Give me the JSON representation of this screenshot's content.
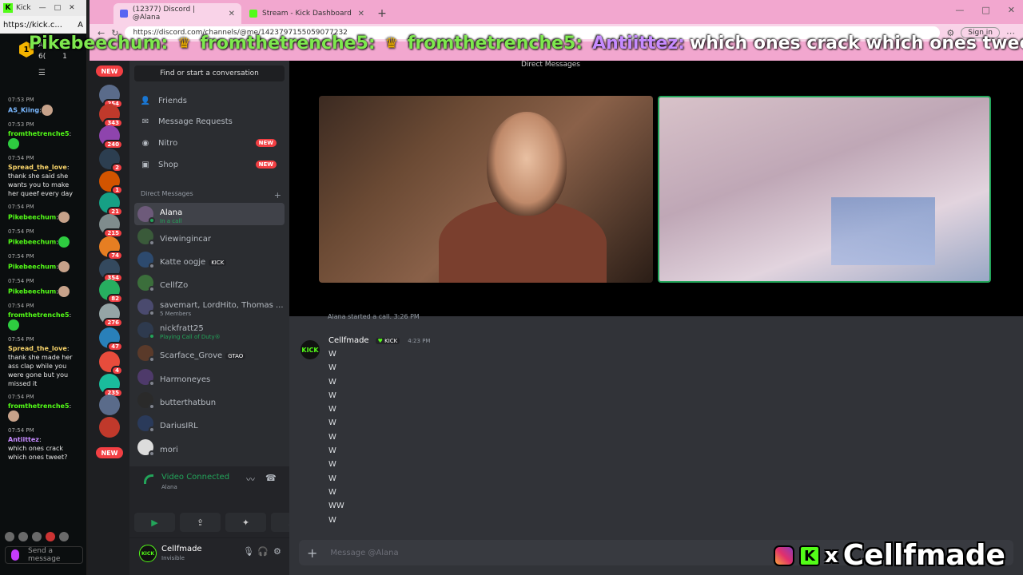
{
  "kick_popup": {
    "window_title": "Kick",
    "url": "https://kick.c...",
    "header": {
      "line1": "A",
      "line2": "6(",
      "count1": "1",
      "count2": "1"
    },
    "messages": [
      {
        "time": "07:53 PM",
        "user": "AS_Kiing",
        "color": "n-blue",
        "text": ""
      },
      {
        "time": "07:53 PM",
        "user": "fromthetrenche5",
        "color": "n-green",
        "text": ""
      },
      {
        "time": "07:54 PM",
        "user": "Spread_the_love",
        "color": "n-yellow",
        "text": "thank she said she wants you to make her queef every day"
      },
      {
        "time": "07:54 PM",
        "user": "Pikebeechum",
        "color": "n-green",
        "text": ""
      },
      {
        "time": "07:54 PM",
        "user": "Pikebeechum",
        "color": "n-green",
        "text": ""
      },
      {
        "time": "07:54 PM",
        "user": "Pikebeechum",
        "color": "n-green",
        "text": ""
      },
      {
        "time": "07:54 PM",
        "user": "Pikebeechum",
        "color": "n-green",
        "text": ""
      },
      {
        "time": "07:54 PM",
        "user": "fromthetrenche5",
        "color": "n-green",
        "text": ""
      },
      {
        "time": "07:54 PM",
        "user": "Spread_the_love",
        "color": "n-yellow",
        "text": "thank she made her ass clap while you were gone but you missed it"
      },
      {
        "time": "07:54 PM",
        "user": "fromthetrenche5",
        "color": "n-green",
        "text": ""
      },
      {
        "time": "07:54 PM",
        "user": "Antiittez",
        "color": "n-purple",
        "text": "which ones crack which ones tweet?"
      }
    ],
    "send_placeholder": "Send a message"
  },
  "browser": {
    "tabs": [
      {
        "label": "(12377) Discord | @Alana",
        "active": true
      },
      {
        "label": "Stream - Kick Dashboard",
        "active": false
      }
    ],
    "url": "https://discord.com/channels/@me/1423797155059077232",
    "signin": "Sign in"
  },
  "ticker": {
    "parts": [
      {
        "name": "Pikebeechum:",
        "color": "nm-green"
      },
      {
        "name": "fromthetrenche5:",
        "color": "nm-green"
      },
      {
        "name": "fromthetrenche5:",
        "color": "nm-green"
      },
      {
        "name": "Antiittez:",
        "color": "nm-purple"
      }
    ],
    "text": "which ones crack which ones tweet?"
  },
  "discord": {
    "guild_badges": [
      "254",
      "343",
      "240",
      "2",
      "1",
      "21",
      "215",
      "74",
      "354",
      "82",
      "276",
      "47",
      "4",
      "235"
    ],
    "new_label": "NEW",
    "find": "Find or start a conversation",
    "nav": {
      "friends": "Friends",
      "requests": "Message Requests",
      "nitro": "Nitro",
      "shop": "Shop",
      "new_badge": "NEW"
    },
    "dm_header": "Direct Messages",
    "dm_add": "+",
    "dms": [
      {
        "name": "Alana",
        "sub": "In a call",
        "active": true
      },
      {
        "name": "Viewingincar",
        "sub": ""
      },
      {
        "name": "Katte oogje",
        "sub": "",
        "badge": "KICK"
      },
      {
        "name": "CellfZo",
        "sub": ""
      },
      {
        "name": "savemart, LordHito, Thomas ...",
        "sub": "5 Members"
      },
      {
        "name": "nickfratt25",
        "sub": "Playing Call of Duty®"
      },
      {
        "name": "Scarface_Grove",
        "sub": "",
        "badge": "GTAO"
      },
      {
        "name": "Harmoneyes",
        "sub": ""
      },
      {
        "name": "butterthatbun",
        "sub": ""
      },
      {
        "name": "DariusIRL",
        "sub": ""
      },
      {
        "name": "mori",
        "sub": ""
      }
    ],
    "voice": {
      "title": "Video Connected",
      "sub": "Alana"
    },
    "user": {
      "name": "Cellfmade",
      "status": "Invisible",
      "avatar_text": "KICK"
    },
    "dm_title": "Direct Messages",
    "system_line": "Alana started a call. 3:26 PM",
    "message": {
      "author": "Cellfmade",
      "badge": "KICK",
      "time": "4:23 PM",
      "avatar_text": "KICK",
      "lines": [
        "W",
        "W",
        "W",
        "W",
        "W",
        "W",
        "W",
        "W",
        "W",
        "W",
        "W",
        "WW",
        "W"
      ]
    },
    "composer_placeholder": "Message @Alana"
  },
  "brand": {
    "x": "x",
    "name": "Cellfmade"
  }
}
